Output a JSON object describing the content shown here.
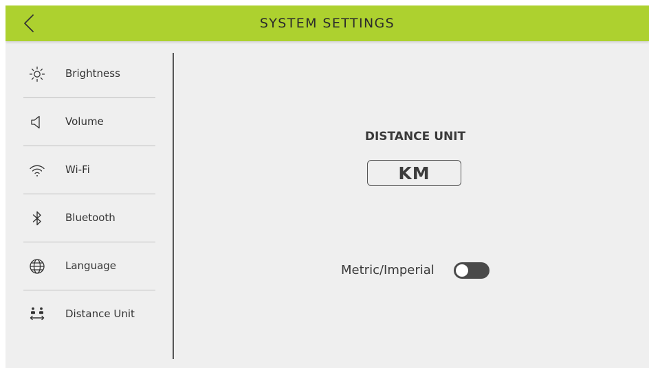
{
  "header": {
    "title": "SYSTEM SETTINGS",
    "back_icon": "chevron-left-icon",
    "background_color": "#add12f"
  },
  "sidebar": {
    "items": [
      {
        "label": "Brightness",
        "icon": "brightness-icon"
      },
      {
        "label": "Volume",
        "icon": "speaker-icon"
      },
      {
        "label": "Wi-Fi",
        "icon": "wifi-icon"
      },
      {
        "label": "Bluetooth",
        "icon": "bluetooth-icon"
      },
      {
        "label": "Language",
        "icon": "globe-icon"
      },
      {
        "label": "Distance Unit",
        "icon": "distance-unit-icon"
      }
    ]
  },
  "main": {
    "section_title": "DISTANCE UNIT",
    "unit_value": "KM",
    "toggle": {
      "label": "Metric/Imperial",
      "state": "off"
    }
  }
}
